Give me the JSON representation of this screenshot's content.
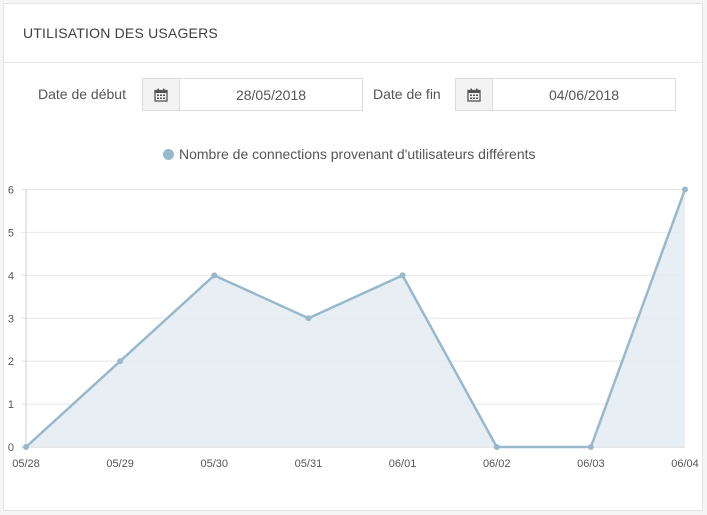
{
  "header": {
    "title": "UTILISATION DES USAGERS"
  },
  "filters": {
    "start_label": "Date de début",
    "start_value": "28/05/2018",
    "end_label": "Date de fin",
    "end_value": "04/06/2018"
  },
  "icons": {
    "calendar": "calendar-icon"
  },
  "colors": {
    "series_line": "#98b8cc",
    "series_fill": "#e3ecf3",
    "grid": "#e6e6e6"
  },
  "chart_data": {
    "type": "area",
    "categories": [
      "05/28",
      "05/29",
      "05/30",
      "05/31",
      "06/01",
      "06/02",
      "06/03",
      "06/04"
    ],
    "series": [
      {
        "name": "Nombre de connections provenant d'utilisateurs différents",
        "values": [
          0,
          2,
          4,
          3,
          4,
          0,
          0,
          6
        ]
      }
    ],
    "ylim": [
      0,
      6
    ],
    "yticks": [
      "0",
      "1",
      "2",
      "3",
      "4",
      "5",
      "6"
    ],
    "grid": true,
    "legend": "top-center"
  }
}
